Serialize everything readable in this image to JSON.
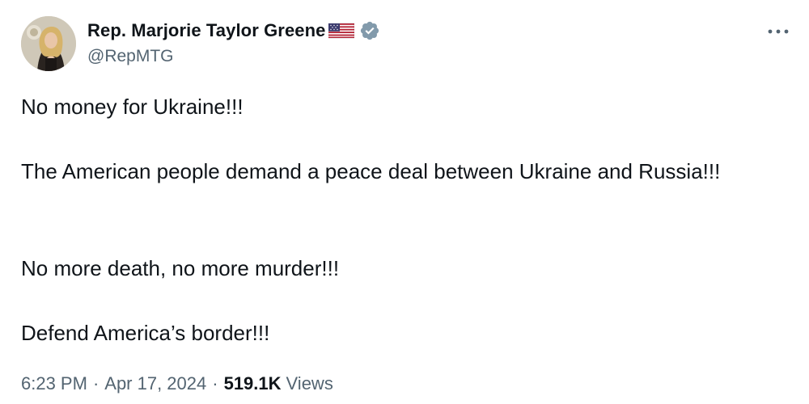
{
  "author": {
    "display_name": "Rep. Marjorie Taylor Greene",
    "handle": "@RepMTG",
    "flag_icon": "us-flag-icon",
    "verified_icon": "verified-badge-icon",
    "verified_color": "#829aab"
  },
  "tweet": {
    "paragraphs": [
      "No money for Ukraine!!!",
      "The American people demand a peace deal between Ukraine and Russia!!!",
      "No more death, no more murder!!!",
      "Defend America’s border!!!"
    ]
  },
  "meta": {
    "time": "6:23 PM",
    "separator": "·",
    "date": "Apr 17, 2024",
    "views_count": "519.1K",
    "views_label": "Views"
  },
  "menu": {
    "more_icon": "more-horizontal-icon"
  },
  "colors": {
    "text_primary": "#0f1419",
    "text_secondary": "#536471",
    "background": "#ffffff"
  }
}
